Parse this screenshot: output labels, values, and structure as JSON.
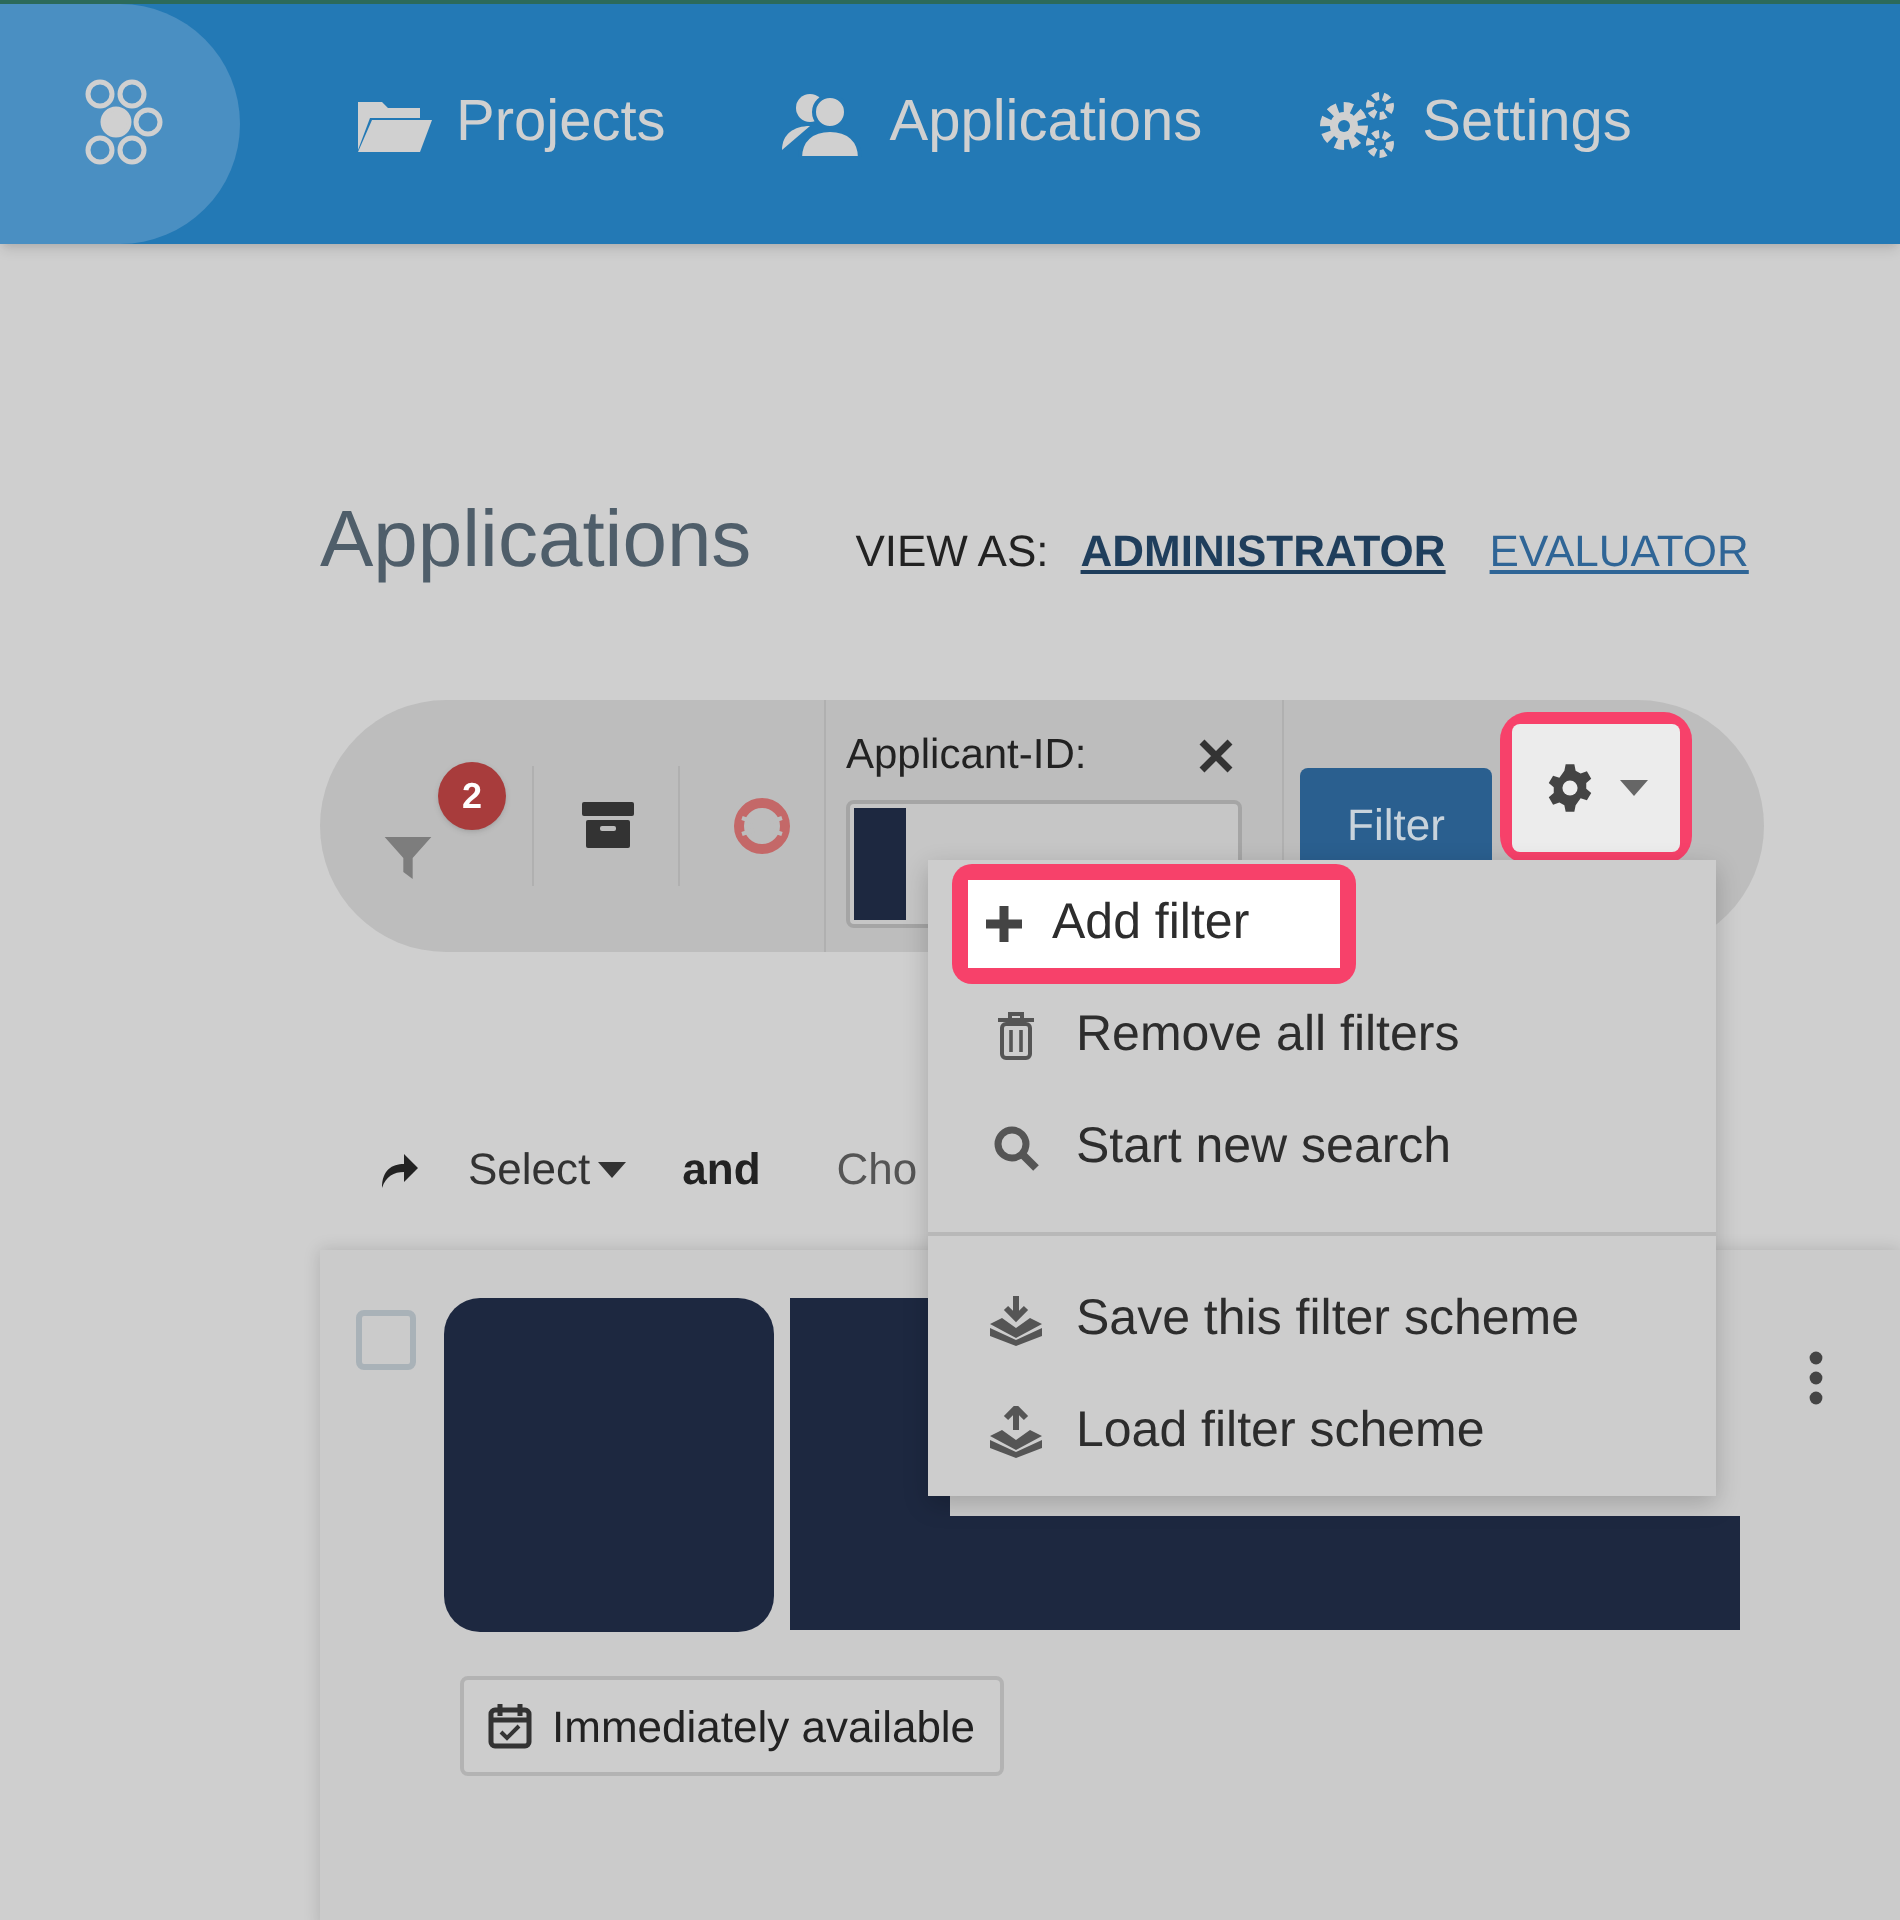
{
  "nav": {
    "items": [
      {
        "label": "Projects"
      },
      {
        "label": "Applications"
      },
      {
        "label": "Settings"
      }
    ]
  },
  "page": {
    "title": "Applications",
    "view_as": {
      "label": "VIEW AS:",
      "options": [
        {
          "label": "ADMINISTRATOR",
          "selected": true
        },
        {
          "label": "EVALUATOR",
          "selected": false
        }
      ]
    }
  },
  "filter_bar": {
    "filter_count": "2",
    "field": {
      "label": "Applicant-ID:"
    },
    "filter_button": "Filter",
    "settings_button": {
      "highlighted": true
    }
  },
  "settings_menu": {
    "groups": [
      [
        {
          "label": "Add filter",
          "highlighted": true
        },
        {
          "label": "Remove all filters",
          "highlighted": false
        },
        {
          "label": "Start new search",
          "highlighted": false
        }
      ],
      [
        {
          "label": "Save this filter scheme",
          "highlighted": false
        },
        {
          "label": "Load filter scheme",
          "highlighted": false
        }
      ]
    ]
  },
  "actions": {
    "select": "Select",
    "conjunction": "and",
    "choose": "Cho"
  },
  "card": {
    "checked": false,
    "badge": "Immediately available"
  }
}
